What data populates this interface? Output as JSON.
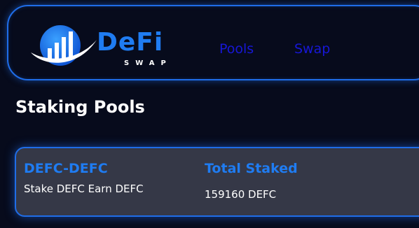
{
  "brand": {
    "name": "DeFi",
    "subtitle": "SWAP",
    "logo_icon": "bar-chart-swoosh-icon",
    "accent_color": "#1f7cf2"
  },
  "nav": {
    "items": [
      {
        "label": "Pools"
      },
      {
        "label": "Swap"
      }
    ],
    "link_color": "#1717d6"
  },
  "page": {
    "title": "Staking Pools"
  },
  "pools": [
    {
      "name": "DEFC-DEFC",
      "description": "Stake DEFC Earn DEFC",
      "total_staked_label": "Total Staked",
      "total_staked_value": "159160 DEFC"
    }
  ]
}
